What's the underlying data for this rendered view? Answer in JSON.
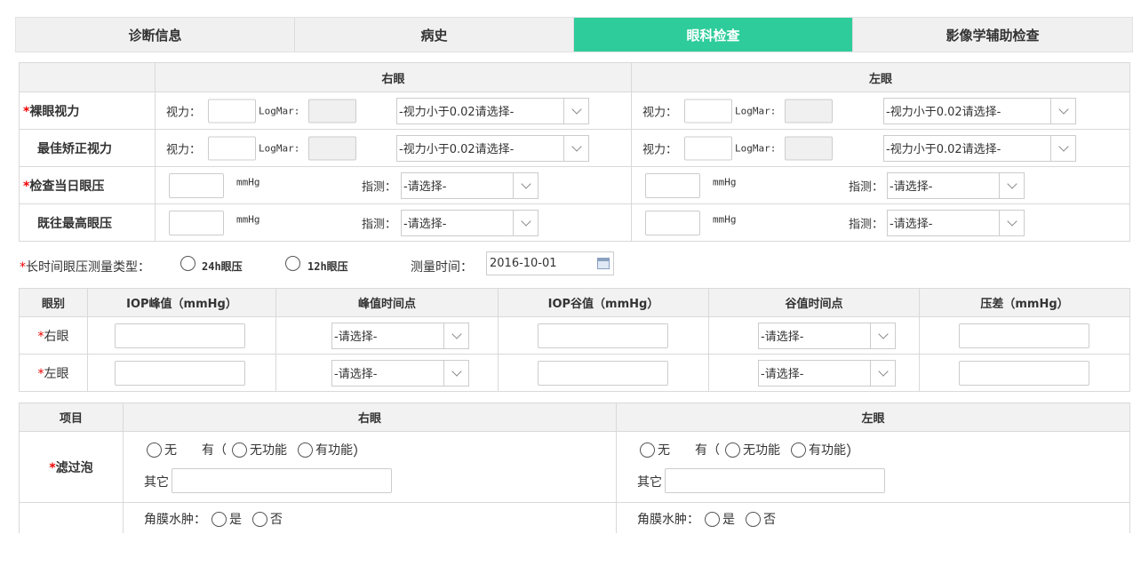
{
  "tabs": [
    "诊断信息",
    "病史",
    "眼科检查",
    "影像学辅助检查"
  ],
  "active_tab": 2,
  "colors": {
    "accent": "#2ecc9a",
    "required": "#ee0000",
    "header_bg": "#f2f2f2"
  },
  "vision": {
    "right_eye": "右眼",
    "left_eye": "左眼",
    "rows": [
      {
        "label": "裸眼视力",
        "required": true
      },
      {
        "label": "最佳矫正视力",
        "required": false
      }
    ],
    "vision_label": "视力：",
    "logmar_label": "LogMar:",
    "select_text": "-视力小于0.02请选择-"
  },
  "pressure": {
    "rows": [
      {
        "label": "检查当日眼压",
        "required": true
      },
      {
        "label": "既往最高眼压",
        "required": false
      }
    ],
    "unit": "mmHg",
    "finger_label": "指测：",
    "select_text": "-请选择-"
  },
  "long_term": {
    "label": "长时间眼压测量类型：",
    "option_24h": "24h眼压",
    "option_12h": "12h眼压",
    "time_label": "测量时间：",
    "time_value": "2016-10-01"
  },
  "iop_table": {
    "headers": [
      "眼别",
      "IOP峰值（mmHg）",
      "峰值时间点",
      "IOP谷值（mmHg）",
      "谷值时间点",
      "压差（mmHg）"
    ],
    "rows": [
      {
        "label": "右眼"
      },
      {
        "label": "左眼"
      }
    ],
    "select_text": "-请选择-"
  },
  "items_table": {
    "headers": [
      "项目",
      "右眼",
      "左眼"
    ],
    "bleb_label": "滤过泡",
    "none": "无",
    "has": "有（",
    "close_paren": "）",
    "no_function": "无功能",
    "has_function": "有功能",
    "other": "其它",
    "cornea_edema": "角膜水肿：",
    "yes": "是",
    "no": "否"
  }
}
